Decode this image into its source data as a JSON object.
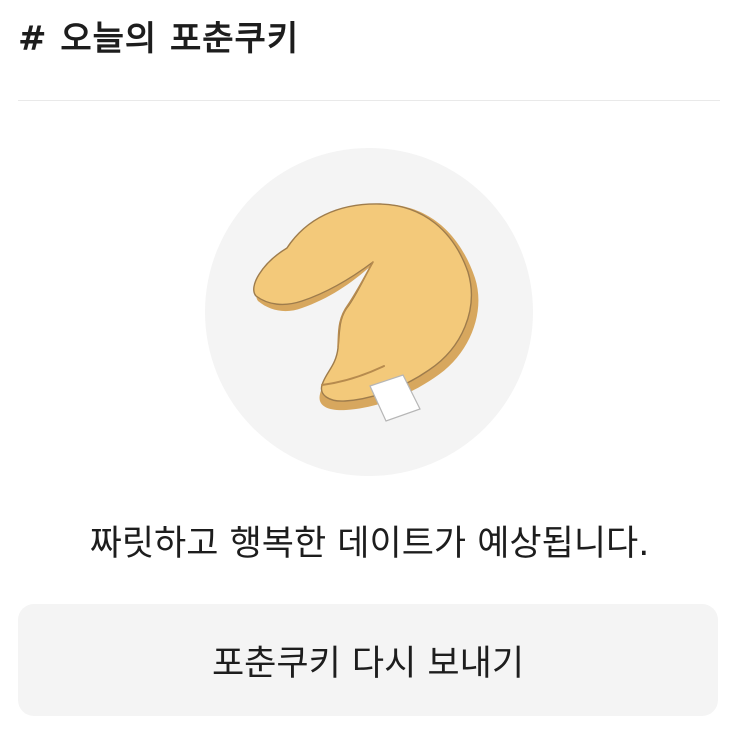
{
  "header": {
    "title": "# 오늘의 포춘쿠키"
  },
  "illustration": {
    "icon": "fortune-cookie-icon",
    "background_color": "#f4f4f4",
    "cookie_color": "#f3c97a",
    "cookie_shadow_color": "#d7a75e",
    "note_color": "#ffffff"
  },
  "fortune": {
    "message": "짜릿하고 행복한 데이트가 예상됩니다."
  },
  "actions": {
    "resend_label": "포춘쿠키 다시 보내기"
  }
}
